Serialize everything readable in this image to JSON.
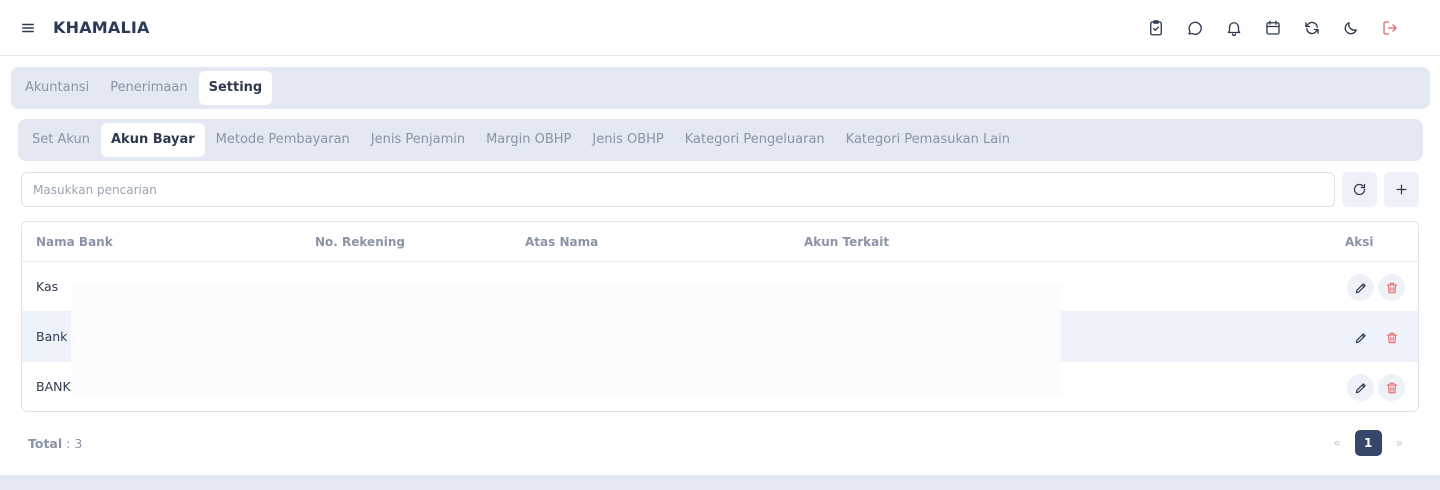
{
  "header": {
    "brand": "KHAMALIA",
    "icons": [
      "menu-icon",
      "clipboard-check-icon",
      "chat-icon",
      "bell-icon",
      "calendar-icon",
      "refresh-icon",
      "moon-icon",
      "logout-icon"
    ]
  },
  "tabs_main": [
    "Akuntansi",
    "Penerimaan",
    "Setting"
  ],
  "tabs_main_active": "Setting",
  "tabs_setting": [
    "Set Akun",
    "Akun Bayar",
    "Metode Pembayaran",
    "Jenis Penjamin",
    "Margin OBHP",
    "Jenis OBHP",
    "Kategori Pengeluaran",
    "Kategori Pemasukan Lain"
  ],
  "tabs_setting_active": "Akun Bayar",
  "search": {
    "placeholder": "Masukkan pencarian"
  },
  "table": {
    "columns": [
      "Nama Bank",
      "No. Rekening",
      "Atas Nama",
      "Akun Terkait",
      "Aksi"
    ],
    "rows": [
      {
        "nama_bank": "Kas"
      },
      {
        "nama_bank": "Bank I"
      },
      {
        "nama_bank": "BANK"
      }
    ]
  },
  "footer": {
    "total_label": "Total",
    "total_value": ": 3",
    "page": "1",
    "prev": "«",
    "next": "»"
  },
  "colors": {
    "accent": "#37476a",
    "danger": "#e26d6d",
    "tab_bg": "#e3e8f3"
  }
}
